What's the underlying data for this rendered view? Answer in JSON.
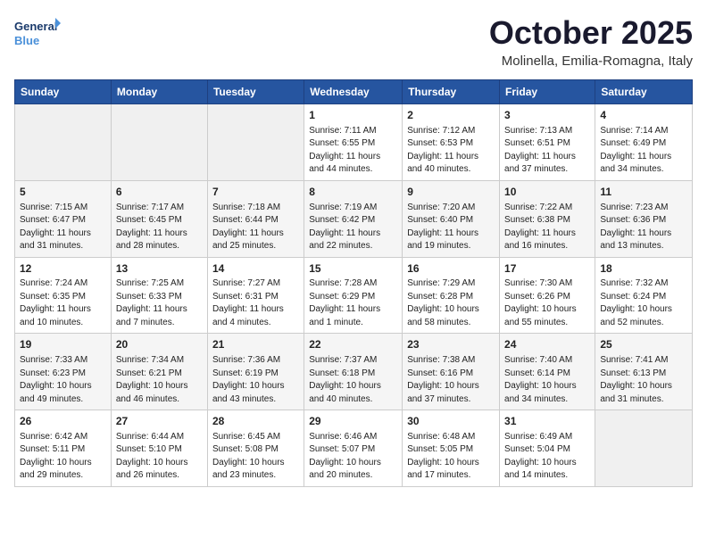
{
  "header": {
    "logo_line1": "General",
    "logo_line2": "Blue",
    "month": "October 2025",
    "location": "Molinella, Emilia-Romagna, Italy"
  },
  "weekdays": [
    "Sunday",
    "Monday",
    "Tuesday",
    "Wednesday",
    "Thursday",
    "Friday",
    "Saturday"
  ],
  "weeks": [
    [
      {
        "day": "",
        "info": ""
      },
      {
        "day": "",
        "info": ""
      },
      {
        "day": "",
        "info": ""
      },
      {
        "day": "1",
        "info": "Sunrise: 7:11 AM\nSunset: 6:55 PM\nDaylight: 11 hours and 44 minutes."
      },
      {
        "day": "2",
        "info": "Sunrise: 7:12 AM\nSunset: 6:53 PM\nDaylight: 11 hours and 40 minutes."
      },
      {
        "day": "3",
        "info": "Sunrise: 7:13 AM\nSunset: 6:51 PM\nDaylight: 11 hours and 37 minutes."
      },
      {
        "day": "4",
        "info": "Sunrise: 7:14 AM\nSunset: 6:49 PM\nDaylight: 11 hours and 34 minutes."
      }
    ],
    [
      {
        "day": "5",
        "info": "Sunrise: 7:15 AM\nSunset: 6:47 PM\nDaylight: 11 hours and 31 minutes."
      },
      {
        "day": "6",
        "info": "Sunrise: 7:17 AM\nSunset: 6:45 PM\nDaylight: 11 hours and 28 minutes."
      },
      {
        "day": "7",
        "info": "Sunrise: 7:18 AM\nSunset: 6:44 PM\nDaylight: 11 hours and 25 minutes."
      },
      {
        "day": "8",
        "info": "Sunrise: 7:19 AM\nSunset: 6:42 PM\nDaylight: 11 hours and 22 minutes."
      },
      {
        "day": "9",
        "info": "Sunrise: 7:20 AM\nSunset: 6:40 PM\nDaylight: 11 hours and 19 minutes."
      },
      {
        "day": "10",
        "info": "Sunrise: 7:22 AM\nSunset: 6:38 PM\nDaylight: 11 hours and 16 minutes."
      },
      {
        "day": "11",
        "info": "Sunrise: 7:23 AM\nSunset: 6:36 PM\nDaylight: 11 hours and 13 minutes."
      }
    ],
    [
      {
        "day": "12",
        "info": "Sunrise: 7:24 AM\nSunset: 6:35 PM\nDaylight: 11 hours and 10 minutes."
      },
      {
        "day": "13",
        "info": "Sunrise: 7:25 AM\nSunset: 6:33 PM\nDaylight: 11 hours and 7 minutes."
      },
      {
        "day": "14",
        "info": "Sunrise: 7:27 AM\nSunset: 6:31 PM\nDaylight: 11 hours and 4 minutes."
      },
      {
        "day": "15",
        "info": "Sunrise: 7:28 AM\nSunset: 6:29 PM\nDaylight: 11 hours and 1 minute."
      },
      {
        "day": "16",
        "info": "Sunrise: 7:29 AM\nSunset: 6:28 PM\nDaylight: 10 hours and 58 minutes."
      },
      {
        "day": "17",
        "info": "Sunrise: 7:30 AM\nSunset: 6:26 PM\nDaylight: 10 hours and 55 minutes."
      },
      {
        "day": "18",
        "info": "Sunrise: 7:32 AM\nSunset: 6:24 PM\nDaylight: 10 hours and 52 minutes."
      }
    ],
    [
      {
        "day": "19",
        "info": "Sunrise: 7:33 AM\nSunset: 6:23 PM\nDaylight: 10 hours and 49 minutes."
      },
      {
        "day": "20",
        "info": "Sunrise: 7:34 AM\nSunset: 6:21 PM\nDaylight: 10 hours and 46 minutes."
      },
      {
        "day": "21",
        "info": "Sunrise: 7:36 AM\nSunset: 6:19 PM\nDaylight: 10 hours and 43 minutes."
      },
      {
        "day": "22",
        "info": "Sunrise: 7:37 AM\nSunset: 6:18 PM\nDaylight: 10 hours and 40 minutes."
      },
      {
        "day": "23",
        "info": "Sunrise: 7:38 AM\nSunset: 6:16 PM\nDaylight: 10 hours and 37 minutes."
      },
      {
        "day": "24",
        "info": "Sunrise: 7:40 AM\nSunset: 6:14 PM\nDaylight: 10 hours and 34 minutes."
      },
      {
        "day": "25",
        "info": "Sunrise: 7:41 AM\nSunset: 6:13 PM\nDaylight: 10 hours and 31 minutes."
      }
    ],
    [
      {
        "day": "26",
        "info": "Sunrise: 6:42 AM\nSunset: 5:11 PM\nDaylight: 10 hours and 29 minutes."
      },
      {
        "day": "27",
        "info": "Sunrise: 6:44 AM\nSunset: 5:10 PM\nDaylight: 10 hours and 26 minutes."
      },
      {
        "day": "28",
        "info": "Sunrise: 6:45 AM\nSunset: 5:08 PM\nDaylight: 10 hours and 23 minutes."
      },
      {
        "day": "29",
        "info": "Sunrise: 6:46 AM\nSunset: 5:07 PM\nDaylight: 10 hours and 20 minutes."
      },
      {
        "day": "30",
        "info": "Sunrise: 6:48 AM\nSunset: 5:05 PM\nDaylight: 10 hours and 17 minutes."
      },
      {
        "day": "31",
        "info": "Sunrise: 6:49 AM\nSunset: 5:04 PM\nDaylight: 10 hours and 14 minutes."
      },
      {
        "day": "",
        "info": ""
      }
    ]
  ]
}
